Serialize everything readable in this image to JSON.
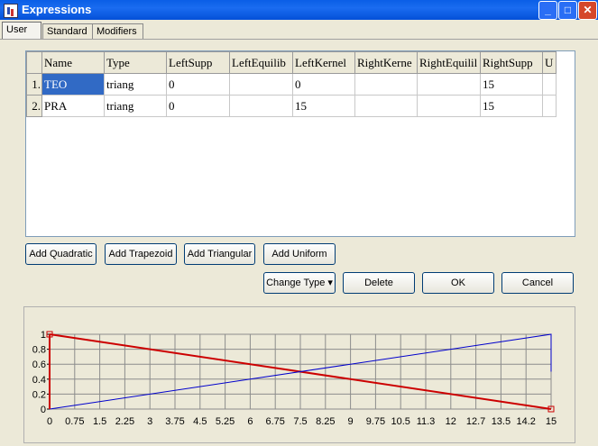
{
  "window": {
    "title": "Expressions"
  },
  "tabs": [
    {
      "label": "User",
      "active": true
    },
    {
      "label": "Standard",
      "active": false
    },
    {
      "label": "Modifiers",
      "active": false
    }
  ],
  "table": {
    "columns": [
      "Name",
      "Type",
      "LeftSupp",
      "LeftEquilib",
      "LeftKernel",
      "RightKerne",
      "RightEquilil",
      "RightSupp",
      "U"
    ],
    "rows": [
      {
        "num": "1.",
        "cells": [
          "TEO",
          "triang",
          "0",
          "",
          "0",
          "",
          "",
          "15",
          ""
        ]
      },
      {
        "num": "2.",
        "cells": [
          "PRA",
          "triang",
          "0",
          "",
          "15",
          "",
          "",
          "15",
          ""
        ]
      }
    ]
  },
  "buttons": {
    "add_quadratic": "Add Quadratic",
    "add_trapezoid": "Add Trapezoid",
    "add_triangular": "Add Triangular",
    "add_uniform": "Add Uniform",
    "change_type": "Change Type",
    "change_type_arrow": "▾",
    "delete": "Delete",
    "ok": "OK",
    "cancel": "Cancel"
  },
  "chart_data": {
    "type": "line",
    "title": "",
    "xlabel": "",
    "ylabel": "",
    "xlim": [
      0,
      15
    ],
    "ylim": [
      0,
      1
    ],
    "x_ticks": [
      "0",
      "0.75",
      "1.5",
      "2.25",
      "3",
      "3.75",
      "4.5",
      "5.25",
      "6",
      "6.75",
      "7.5",
      "8.25",
      "9",
      "9.75",
      "10.5",
      "11.3",
      "12",
      "12.7",
      "13.5",
      "14.2",
      "15"
    ],
    "y_ticks": [
      "0",
      "0.2",
      "0.4",
      "0.6",
      "0.8",
      "1"
    ],
    "grid": true,
    "series": [
      {
        "color": "#cc0000",
        "x": [
          0,
          15
        ],
        "y": [
          1,
          0
        ],
        "markers": true
      },
      {
        "color": "#0000cc",
        "x": [
          0,
          15,
          15
        ],
        "y": [
          0,
          1,
          0.5
        ],
        "markers": false
      }
    ]
  }
}
